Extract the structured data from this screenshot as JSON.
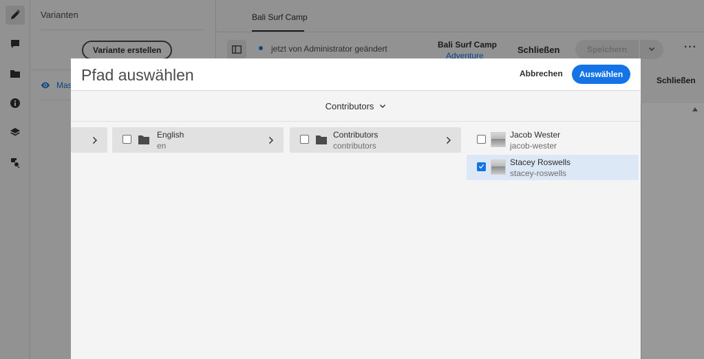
{
  "panel": {
    "title": "Varianten",
    "create_variant_label": "Variante erstellen",
    "master_label": "Master"
  },
  "tabs": [
    {
      "label": "Bali Surf Camp"
    }
  ],
  "toolbar": {
    "modified_text": "jetzt von Administrator geändert",
    "fragment_title": "Bali Surf Camp",
    "fragment_model": "Adventure",
    "close_label": "Schließen",
    "save_label": "Speichern",
    "more_label": "···"
  },
  "background": {
    "close_label": "Schließen"
  },
  "dialog": {
    "title": "Pfad auswählen",
    "cancel_label": "Abbrechen",
    "select_label": "Auswählen",
    "breadcrumb": "Contributors",
    "columns": [
      {
        "title": "",
        "subtitle": ""
      },
      {
        "title": "English",
        "subtitle": "en"
      },
      {
        "title": "Contributors",
        "subtitle": "contributors"
      }
    ],
    "items": [
      {
        "title": "Jacob Wester",
        "subtitle": "jacob-wester",
        "checked": false
      },
      {
        "title": "Stacey Roswells",
        "subtitle": "stacey-roswells",
        "checked": true
      }
    ]
  },
  "colors": {
    "accent": "#1473e6",
    "selected_row": "#dde8f6"
  }
}
